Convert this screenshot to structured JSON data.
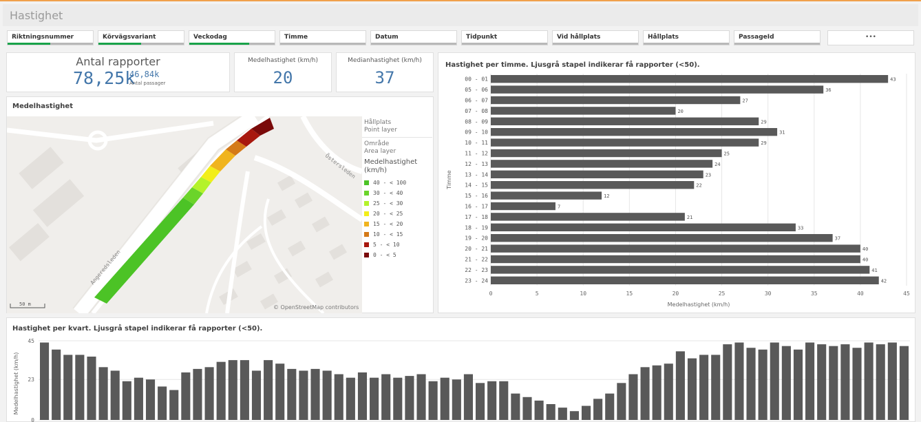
{
  "app": {
    "title": "Hastighet"
  },
  "filters": [
    {
      "label": "Riktningsnummer",
      "fill": 0.5
    },
    {
      "label": "Körvägsvariant",
      "fill": 0.5
    },
    {
      "label": "Veckodag",
      "fill": 0.7
    },
    {
      "label": "Timme",
      "fill": 0
    },
    {
      "label": "Datum",
      "fill": 0
    },
    {
      "label": "Tidpunkt",
      "fill": 0
    },
    {
      "label": "Vid hållplats",
      "fill": 0
    },
    {
      "label": "Hållplats",
      "fill": 0
    },
    {
      "label": "PassageId",
      "fill": 0
    }
  ],
  "more_label": "•••",
  "kpi": {
    "reports_title": "Antal rapporter",
    "reports_value": "78,25k",
    "passages_value": "46,84k",
    "passages_label": "Antal passager",
    "mean_title": "Medelhastighet (km/h)",
    "mean_value": "20",
    "median_title": "Medianhastighet (km/h)",
    "median_value": "37"
  },
  "map": {
    "title": "Medelhastighet",
    "street_1": "Angeredsleden",
    "street_2": "Östersleden",
    "scale": "50 m",
    "attribution": "© OpenStreetMap contributors",
    "legend": {
      "layer1_name": "Hållplats",
      "layer1_type": "Point layer",
      "layer2_name": "Område",
      "layer2_type": "Area layer",
      "measure": "Medelhastighet (km/h)",
      "items": [
        {
          "label": "40 - < 100",
          "color": "#4cc326"
        },
        {
          "label": "30 - < 40",
          "color": "#6bd42a"
        },
        {
          "label": "25 - < 30",
          "color": "#b4f22a"
        },
        {
          "label": "20 - < 25",
          "color": "#f2ee1a"
        },
        {
          "label": "15 - < 20",
          "color": "#f0b41e"
        },
        {
          "label": "10 - < 15",
          "color": "#d47a18"
        },
        {
          "label": "5 - < 10",
          "color": "#a8180e"
        },
        {
          "label": "0 - < 5",
          "color": "#7a0a0a"
        }
      ]
    }
  },
  "chart_data": [
    {
      "type": "bar",
      "orientation": "horizontal",
      "title": "Hastighet per timme. Ljusgrå stapel indikerar få rapporter (<50).",
      "xlabel": "Medelhastighet (km/h)",
      "ylabel": "Timme",
      "xlim": [
        0,
        45
      ],
      "xticks": [
        0,
        5,
        10,
        15,
        20,
        25,
        30,
        35,
        40,
        45
      ],
      "categories": [
        "00 - 01",
        "05 - 06",
        "06 - 07",
        "07 - 08",
        "08 - 09",
        "09 - 10",
        "10 - 11",
        "11 - 12",
        "12 - 13",
        "13 - 14",
        "14 - 15",
        "15 - 16",
        "16 - 17",
        "17 - 18",
        "18 - 19",
        "19 - 20",
        "20 - 21",
        "21 - 22",
        "22 - 23",
        "23 - 24"
      ],
      "values": [
        43,
        36,
        27,
        20,
        29,
        31,
        29,
        25,
        24,
        23,
        22,
        12,
        7,
        21,
        33,
        37,
        40,
        40,
        41,
        42
      ],
      "bar_color": "#595959",
      "grid": true
    },
    {
      "type": "bar",
      "title": "Hastighet per kvart. Ljusgrå stapel indikerar få rapporter (<50).",
      "ylabel": "Medelhastighet (km/h)",
      "ylim": [
        0,
        45
      ],
      "yticks": [
        0,
        23,
        45
      ],
      "values": [
        44,
        40,
        37,
        37,
        36,
        30,
        28,
        22,
        24,
        23,
        19,
        17,
        27,
        29,
        30,
        33,
        34,
        34,
        28,
        34,
        32,
        29,
        28,
        29,
        28,
        26,
        24,
        27,
        24,
        26,
        24,
        25,
        26,
        22,
        24,
        23,
        26,
        21,
        22,
        22,
        15,
        13,
        11,
        9,
        7,
        5,
        8,
        12,
        15,
        21,
        26,
        30,
        31,
        32,
        39,
        35,
        37,
        37,
        43,
        44,
        41,
        40,
        44,
        42,
        40,
        44,
        43,
        42,
        43,
        41,
        44,
        43,
        44,
        42
      ],
      "bar_color": "#595959",
      "grid": true
    }
  ]
}
